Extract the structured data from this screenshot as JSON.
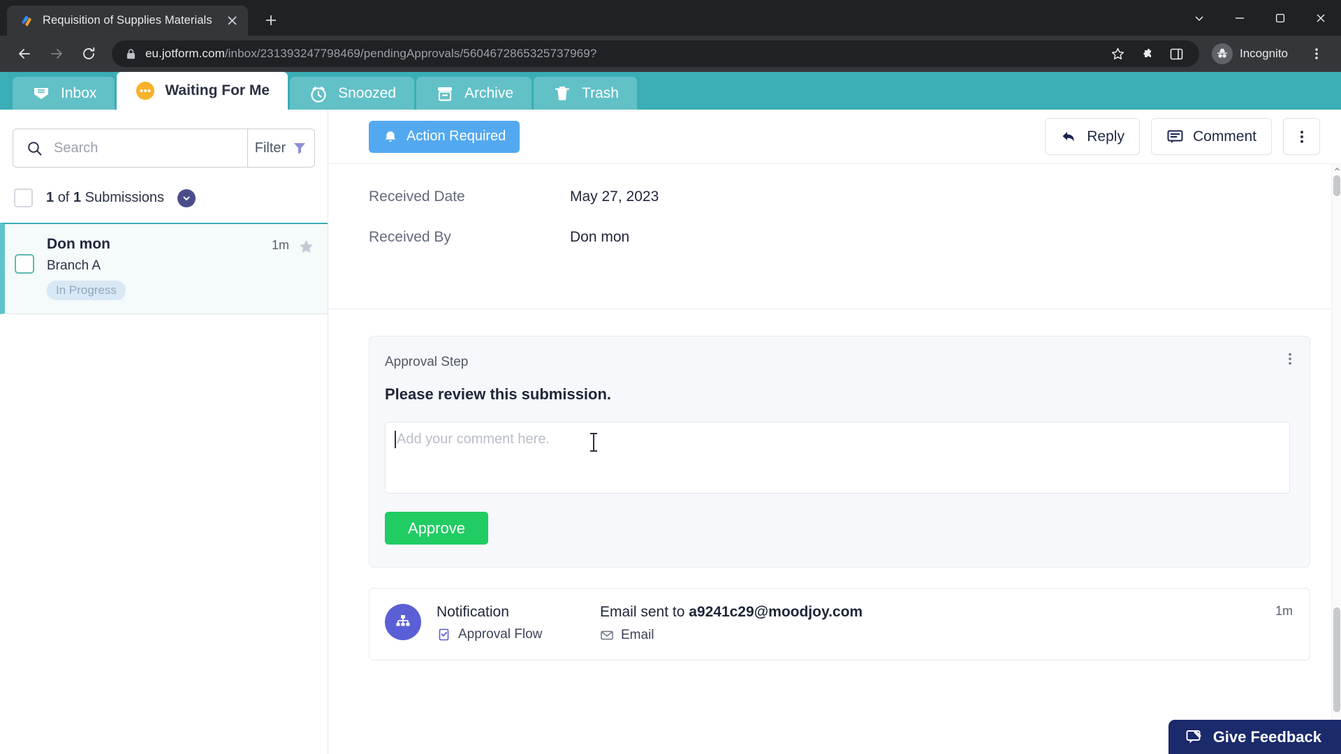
{
  "browser": {
    "tab": {
      "title": "Requisition of Supplies Materials",
      "favicon": "jotform-favicon",
      "close_icon": "close-icon"
    },
    "new_tab_icon": "plus-icon",
    "window_controls": [
      {
        "name": "chevron-down-icon",
        "glyph": "v"
      },
      {
        "name": "minimize-icon",
        "glyph": "minimize"
      },
      {
        "name": "maximize-icon",
        "glyph": "maximize"
      },
      {
        "name": "close-window-icon",
        "glyph": "close"
      }
    ],
    "nav": {
      "back_icon": "back-arrow-icon",
      "forward_icon": "forward-arrow-icon",
      "reload_icon": "reload-icon"
    },
    "url": {
      "lock_icon": "lock-icon",
      "host": "eu.jotform.com",
      "path": "/inbox/231393247798469/pendingApprovals/5604672865325737969?"
    },
    "url_actions": [
      {
        "name": "bookmark-star-icon"
      },
      {
        "name": "extensions-puzzle-icon"
      },
      {
        "name": "side-panel-icon"
      }
    ],
    "incognito": {
      "label": "Incognito",
      "icon": "incognito-icon"
    },
    "menu_icon": "browser-menu-icon"
  },
  "nav_tabs": [
    {
      "label": "Inbox",
      "icon": "inbox-icon",
      "active": false
    },
    {
      "label": "Waiting For Me",
      "icon": "waiting-icon",
      "active": true
    },
    {
      "label": "Snoozed",
      "icon": "clock-icon",
      "active": false
    },
    {
      "label": "Archive",
      "icon": "archive-icon",
      "active": false
    },
    {
      "label": "Trash",
      "icon": "trash-icon",
      "active": false
    }
  ],
  "sidebar": {
    "search": {
      "placeholder": "Search",
      "icon": "search-icon"
    },
    "filter": {
      "label": "Filter",
      "icon": "funnel-icon"
    },
    "submissions_count": {
      "current": "1",
      "total": "1",
      "text_prefix": "of",
      "text_suffix": "Submissions",
      "chevron_icon": "chevron-down-icon"
    },
    "items": [
      {
        "name": "Don mon",
        "subtitle": "Branch A",
        "status": "In Progress",
        "time": "1m",
        "star_icon": "star-icon"
      }
    ]
  },
  "main": {
    "toolbar": {
      "action_required": {
        "label": "Action Required",
        "icon": "bell-icon",
        "color": "#53a9f0"
      },
      "reply": {
        "label": "Reply",
        "icon": "reply-arrow-icon"
      },
      "comment": {
        "label": "Comment",
        "icon": "comment-bubble-icon"
      },
      "more": {
        "icon": "kebab-menu-icon"
      }
    },
    "details": [
      {
        "key": "Received Date",
        "value": "May 27, 2023"
      },
      {
        "key": "Received By",
        "value": "Don mon"
      }
    ],
    "approval_card": {
      "label": "Approval Step",
      "title": "Please review this submission.",
      "kebab_icon": "kebab-menu-icon",
      "comment_placeholder": "Add your comment here.",
      "comment_value": "",
      "approve_label": "Approve",
      "approve_color": "#21cc63"
    },
    "notification": {
      "avatar_icon": "org-chart-icon",
      "title": "Notification",
      "flow_label": "Approval Flow",
      "flow_icon": "clipboard-check-icon",
      "sent_prefix": "Email sent to ",
      "sent_address": "a9241c29@moodjoy.com",
      "channel_label": "Email",
      "channel_icon": "envelope-icon",
      "time": "1m"
    }
  },
  "feedback": {
    "label": "Give Feedback",
    "icon": "feedback-icon",
    "color": "#1b2a6b"
  }
}
